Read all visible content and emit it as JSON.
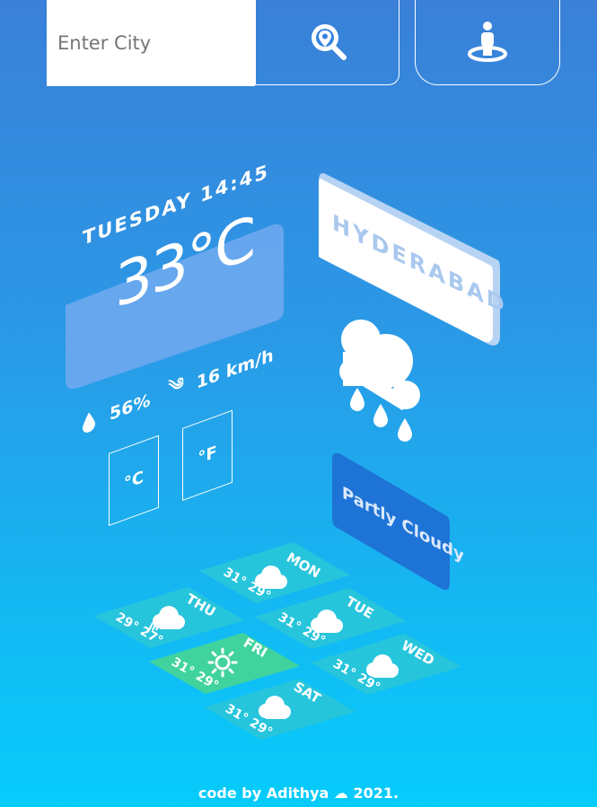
{
  "search": {
    "placeholder": "Enter City",
    "value": ""
  },
  "icons": {
    "search": "location-search-icon",
    "locate": "person-location-icon",
    "humidity": "water-drop-icon",
    "wind": "wind-icon",
    "rain": "rain-cloud-icon"
  },
  "current": {
    "datetime": "TUESDAY 14:45",
    "temperature": "33°C",
    "humidity": "56%",
    "wind": "16 km/h",
    "city": "HYDERABAD",
    "condition": "Partly Cloudy"
  },
  "units": {
    "celsius": "°C",
    "fahrenheit": "°F"
  },
  "forecast": [
    {
      "day": "MON",
      "temps": "31° 29°",
      "icon": "cloud-icon"
    },
    {
      "day": "TUE",
      "temps": "31° 29°",
      "icon": "cloud-icon"
    },
    {
      "day": "WED",
      "temps": "31° 29°",
      "icon": "cloud-icon"
    },
    {
      "day": "THU",
      "temps": "29° 27°",
      "icon": "rain-cloud-icon"
    },
    {
      "day": "FRI",
      "temps": "31° 29°",
      "icon": "sun-icon"
    },
    {
      "day": "SAT",
      "temps": "31° 29°",
      "icon": "cloud-icon"
    }
  ],
  "colors": {
    "tile": "#27c5dc",
    "tile_highlight": "#40d39e",
    "temp_panel": "#6aa8ee",
    "city_card": "#ffffff",
    "city_text": "#a9c8ee",
    "condition_card": "#1e74d6"
  },
  "footer": "code by Adithya ☁ 2021."
}
